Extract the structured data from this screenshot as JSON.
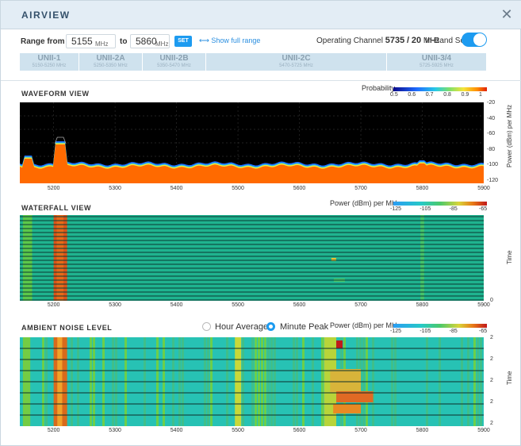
{
  "app_title": "AIRVIEW",
  "close_glyph": "✕",
  "range": {
    "from_label": "Range from",
    "from_value": "5155",
    "to_label": "to",
    "to_value": "5860",
    "unit": "MHz",
    "set_label": "SET",
    "show_full_label": "⟷  Show full range"
  },
  "operating_channel": {
    "label": "Operating Channel",
    "freq": "5735",
    "sep": "/",
    "width": "20",
    "unit": "MHz"
  },
  "in_band_scan": {
    "label": "In-Band Scan",
    "enabled": true
  },
  "bands": [
    {
      "name": "UNII-1",
      "range": "5150-5250 MHz"
    },
    {
      "name": "UNII-2A",
      "range": "5250-5350 MHz"
    },
    {
      "name": "UNII-2B",
      "range": "5350-5470 MHz"
    },
    {
      "name": "UNII-2C",
      "range": "5470-5725 MHz"
    },
    {
      "name": "UNII-3/4",
      "range": "5725-5925 MHz"
    }
  ],
  "waveform": {
    "title": "WAVEFORM VIEW",
    "scale_label": "Probability",
    "scale_ticks": [
      "0.5",
      "0.6",
      "0.7",
      "0.8",
      "0.9",
      "1"
    ],
    "y_label": "Power (dBm) per MHz",
    "y_ticks": [
      "-20",
      "-40",
      "-60",
      "-80",
      "-100",
      "-120"
    ],
    "x_ticks": [
      "5200",
      "5300",
      "5400",
      "5500",
      "5600",
      "5700",
      "5800",
      "5900"
    ]
  },
  "waterfall": {
    "title": "WATERFALL VIEW",
    "scale_label": "Power (dBm) per MHz",
    "scale_ticks": [
      "-125",
      "-105",
      "-85",
      "-65"
    ],
    "y_label": "Time",
    "y_end": "0",
    "x_ticks": [
      "5200",
      "5300",
      "5400",
      "5500",
      "5600",
      "5700",
      "5800",
      "5900"
    ]
  },
  "ambient": {
    "title": "AMBIENT NOISE LEVEL",
    "opt_hour": "Hour Average",
    "opt_minute": "Minute Peak",
    "selected": "Minute Peak",
    "scale_label": "Power (dBm) per MHz",
    "scale_ticks": [
      "-125",
      "-105",
      "-85",
      "-65"
    ],
    "y_label": "Time",
    "y_ticks": [
      "2",
      "2",
      "2",
      "2",
      "2"
    ],
    "x_ticks": [
      "5200",
      "5300",
      "5400",
      "5500",
      "5600",
      "5700",
      "5800",
      "5900"
    ]
  },
  "colors": {
    "accent": "#1d9bf0",
    "titlebar": "#e3edf5",
    "noise_floor": "#ff6a00",
    "waterfall_bg": "#1fb38f"
  }
}
